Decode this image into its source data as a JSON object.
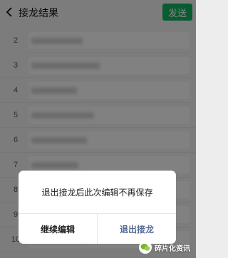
{
  "header": {
    "title": "接龙结果",
    "send_label": "发送",
    "accent_color": "#06ae56"
  },
  "list": {
    "rows": [
      {
        "num": "2"
      },
      {
        "num": "3"
      },
      {
        "num": "4"
      },
      {
        "num": "5"
      },
      {
        "num": "6"
      },
      {
        "num": "7"
      },
      {
        "num": "8"
      },
      {
        "num": "9"
      },
      {
        "num": "10"
      }
    ]
  },
  "dialog": {
    "message": "退出接龙后此次编辑不再保存",
    "continue_label": "继续编辑",
    "exit_label": "退出接龙",
    "exit_color": "#576b95"
  },
  "watermark": {
    "text": "碎片化资讯",
    "icon": "wechat-logo-icon"
  }
}
